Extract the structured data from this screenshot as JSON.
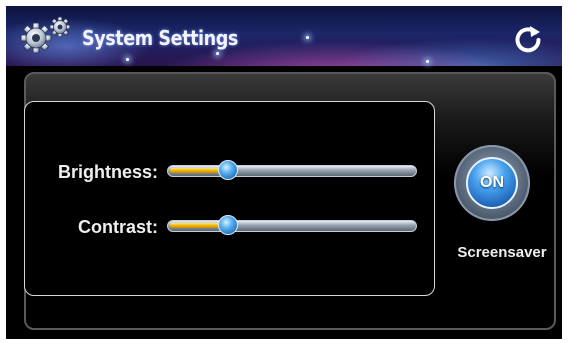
{
  "header": {
    "title": "System Settings",
    "title_icon": "gears-icon",
    "refresh_icon": "refresh-icon"
  },
  "sliders": [
    {
      "label": "Brightness:",
      "value_fraction": 0.24
    },
    {
      "label": "Contrast:",
      "value_fraction": 0.24
    }
  ],
  "screensaver": {
    "button_text": "ON",
    "label": "Screensaver"
  },
  "colors": {
    "accent_blue": "#2f86d8",
    "slider_fill": "#f0b800"
  }
}
